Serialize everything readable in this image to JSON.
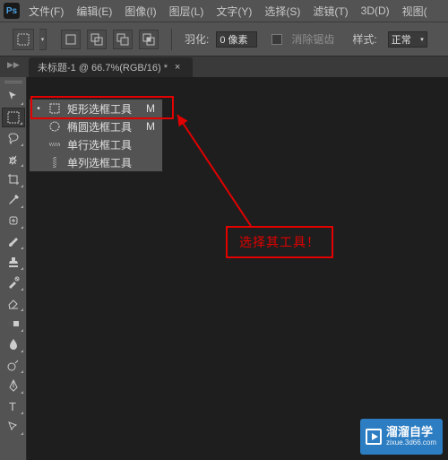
{
  "logo": "Ps",
  "menu": [
    "文件(F)",
    "编辑(E)",
    "图像(I)",
    "图层(L)",
    "文字(Y)",
    "选择(S)",
    "滤镜(T)",
    "3D(D)",
    "视图("
  ],
  "options": {
    "feather_label": "羽化:",
    "feather_value": "0 像素",
    "antialias": "消除锯齿",
    "style_label": "样式:",
    "style_value": "正常"
  },
  "tab": {
    "title": "未标题-1 @ 66.7%(RGB/16) *",
    "close": "×"
  },
  "flyout": {
    "items": [
      {
        "dot": "•",
        "label": "矩形选框工具",
        "shortcut": "M"
      },
      {
        "dot": "",
        "label": "椭圆选框工具",
        "shortcut": "M"
      },
      {
        "dot": "",
        "label": "单行选框工具",
        "shortcut": ""
      },
      {
        "dot": "",
        "label": "单列选框工具",
        "shortcut": ""
      }
    ]
  },
  "callout": "选择其工具！",
  "watermark": {
    "title": "溜溜自学",
    "url": "zixue.3d66.com"
  }
}
